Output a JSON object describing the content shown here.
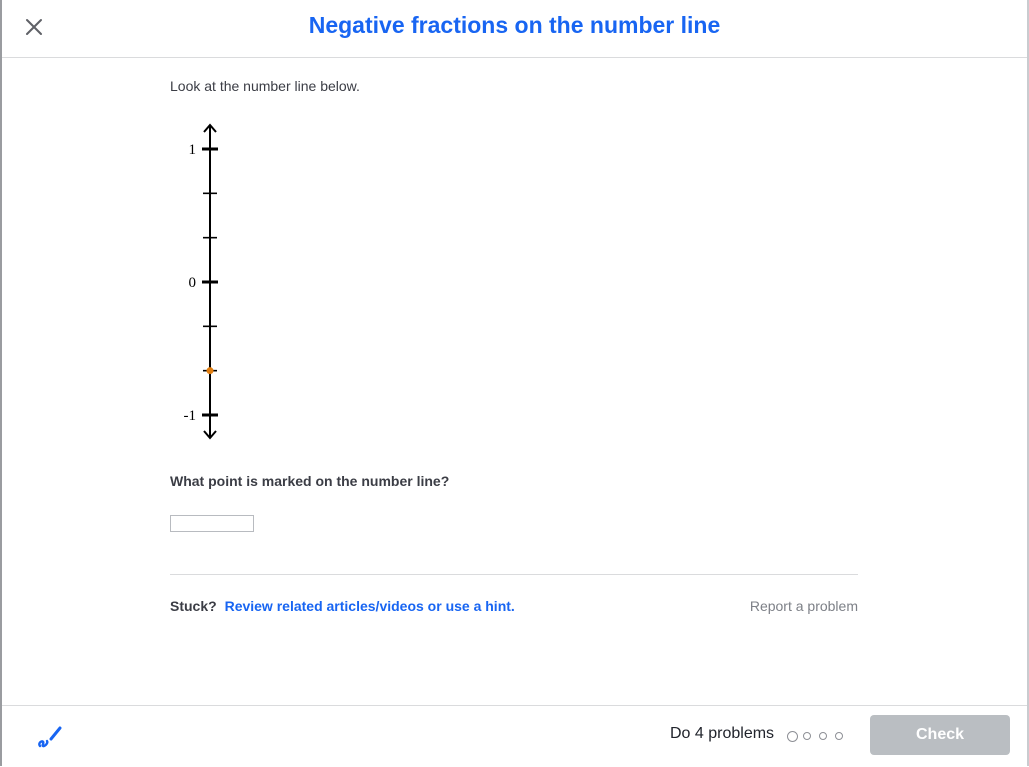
{
  "header": {
    "title": "Negative fractions on the number line",
    "close_icon": "close-icon"
  },
  "exercise": {
    "intro": "Look at the number line below.",
    "number_line": {
      "orientation": "vertical",
      "min": -1,
      "max": 1,
      "labels": [
        "1",
        "0",
        "-1"
      ],
      "tick_values": [
        1,
        0.6667,
        0.3333,
        0,
        -0.3333,
        -0.6667,
        -1
      ],
      "marked_point": -0.6667,
      "marked_point_color": "#e07d10"
    },
    "question": "What point is marked on the number line?",
    "answer": {
      "value": "",
      "placeholder": ""
    }
  },
  "help": {
    "stuck_label": "Stuck?",
    "hint_link": "Review related articles/videos or use a hint.",
    "report_link": "Report a problem"
  },
  "footer": {
    "scratchpad_icon": "pencil-scribble-icon",
    "problems_label": "Do 4 problems",
    "progress_total": 4,
    "progress_completed": 0,
    "check_label": "Check",
    "check_enabled": false
  },
  "colors": {
    "accent": "#1865f2",
    "check_disabled": "#babec2",
    "text": "#21242c"
  }
}
